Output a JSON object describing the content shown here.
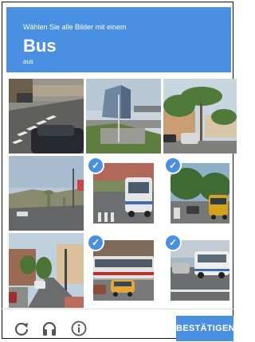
{
  "header": {
    "instruction": "Wählen Sie alle Bilder mit einem",
    "target": "Bus",
    "subtext": "aus",
    "color": "#4a90e2"
  },
  "grid": {
    "tiles": [
      {
        "name": "street-crosswalk",
        "selected": false
      },
      {
        "name": "building-freeway",
        "selected": false
      },
      {
        "name": "palm-tree-street",
        "selected": false
      },
      {
        "name": "road-hill-view",
        "selected": false
      },
      {
        "name": "street-with-bus",
        "selected": true
      },
      {
        "name": "school-bus-street",
        "selected": true
      },
      {
        "name": "downtown-street",
        "selected": false
      },
      {
        "name": "bus-and-taxi",
        "selected": true
      },
      {
        "name": "bus-intersection",
        "selected": true
      }
    ]
  },
  "footer": {
    "reload_icon": "reload-icon",
    "audio_icon": "headphones-icon",
    "info_icon": "info-icon",
    "confirm_label": "BESTÄTIGEN"
  }
}
